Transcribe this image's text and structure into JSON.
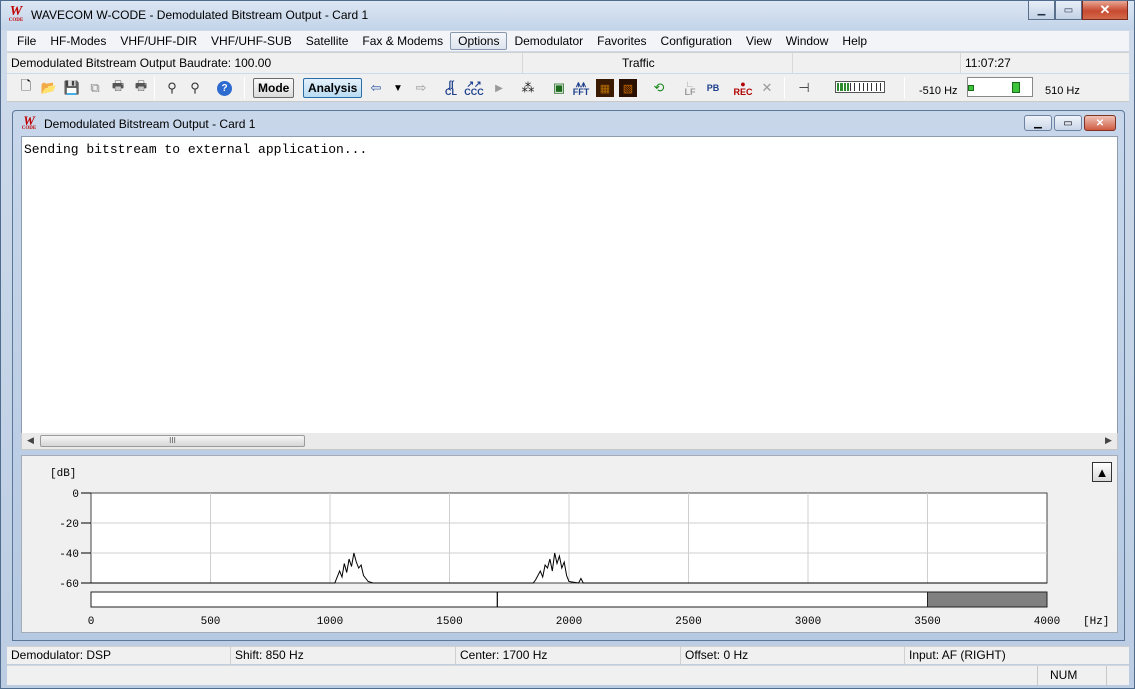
{
  "window": {
    "title": "WAVECOM W-CODE - Demodulated Bitstream Output  - Card 1",
    "logo_letter": "W",
    "logo_word": "CODE",
    "minimize": "▁",
    "maximize": "▭",
    "close": "✕"
  },
  "menu": [
    "File",
    "HF-Modes",
    "VHF/UHF-DIR",
    "VHF/UHF-SUB",
    "Satellite",
    "Fax & Modems",
    "Options",
    "Demodulator",
    "Favorites",
    "Configuration",
    "View",
    "Window",
    "Help"
  ],
  "active_menu_index": 6,
  "infobar": {
    "mode": "Demodulated Bitstream Output  Baudrate: 100.00",
    "traffic": "Traffic",
    "time": "11:07:27"
  },
  "toolbar": {
    "mode_label": "Mode",
    "analysis_label": "Analysis",
    "cl_label": "CL",
    "ccc_label": "CCC",
    "fft_label": "FFT",
    "pb_label": "PB",
    "rec_label": "REC",
    "lf_label": "LF",
    "tune_low": "-510 Hz",
    "tune_high": "510 Hz",
    "level_segments": 12,
    "level_on": 4
  },
  "child": {
    "title": "Demodulated Bitstream Output  - Card 1",
    "logo_letter": "W",
    "logo_word": "CODE",
    "output_text": "Sending bitstream to external application...",
    "scroll_grip": "III"
  },
  "spectrum": {
    "db_label": "[dB]",
    "hz_label": "[Hz]",
    "y_ticks": [
      "0",
      "-20",
      "-40",
      "-60"
    ],
    "x_ticks": [
      "0",
      "500",
      "1000",
      "1500",
      "2000",
      "2500",
      "3000",
      "3500",
      "4000"
    ],
    "center_marker_hz": 1700,
    "shaded_from_hz": 3500,
    "up_button": "▲"
  },
  "chart_data": {
    "type": "line",
    "title": "",
    "xlabel": "[Hz]",
    "ylabel": "[dB]",
    "xlim": [
      0,
      4000
    ],
    "ylim": [
      -60,
      0
    ],
    "grid": true,
    "series": [
      {
        "x": [
          0,
          1020,
          1040,
          1050,
          1060,
          1070,
          1080,
          1090,
          1100,
          1110,
          1120,
          1130,
          1140,
          1150,
          1160,
          1180,
          1800,
          1850,
          1860,
          1880,
          1890,
          1900,
          1910,
          1920,
          1930,
          1940,
          1950,
          1960,
          1970,
          1980,
          1990,
          2000,
          2040,
          2050,
          2060,
          4000
        ],
        "y": [
          -60,
          -60,
          -52,
          -56,
          -47,
          -53,
          -44,
          -49,
          -40,
          -46,
          -50,
          -48,
          -55,
          -57,
          -59,
          -60,
          -60,
          -60,
          -58,
          -52,
          -56,
          -48,
          -50,
          -44,
          -52,
          -40,
          -47,
          -42,
          -50,
          -46,
          -55,
          -59,
          -60,
          -57,
          -60,
          -60
        ]
      }
    ]
  },
  "status": {
    "demodulator": "Demodulator: DSP",
    "shift": "Shift: 850 Hz",
    "center": "Center: 1700 Hz",
    "offset": "Offset: 0 Hz",
    "input": "Input: AF (RIGHT)",
    "num": "NUM"
  }
}
